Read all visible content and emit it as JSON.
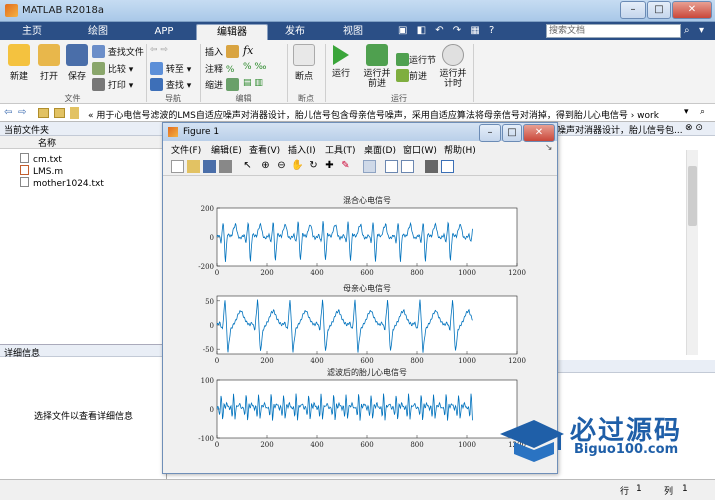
{
  "window": {
    "title": "MATLAB R2018a"
  },
  "tabs": [
    {
      "label": "主页"
    },
    {
      "label": "绘图"
    },
    {
      "label": "APP"
    },
    {
      "label": "编辑器"
    },
    {
      "label": "发布"
    },
    {
      "label": "视图"
    }
  ],
  "search": {
    "placeholder": "搜索文档"
  },
  "ribbon": {
    "new": "新建",
    "open": "打开",
    "save": "保存",
    "find_files": "查找文件",
    "compare": "比较",
    "print": "打印",
    "goto": "转至",
    "find": "查找",
    "insert": "插入",
    "comment": "注释",
    "indent": "缩进",
    "fx": "fx",
    "breakpoints": "断点",
    "run": "运行",
    "run_advance": "运行并\n前进",
    "run_section": "运行节",
    "advance": "前进",
    "run_time": "运行并\n计时",
    "sections": {
      "file": "文件",
      "navigate": "导航",
      "edit": "编辑",
      "breakpoints": "断点",
      "run": "运行"
    }
  },
  "address": {
    "path": "« 用于心电信号滤波的LMS自适应噪声对消器设计，胎儿信号包含母亲信号噪声，采用自适应算法将母亲信号对消掉，得到胎儿心电信号 › work"
  },
  "current_folder": {
    "title": "当前文件夹",
    "column": "名称",
    "files": [
      "cm.txt",
      "LMS.m",
      "mother1024.txt"
    ]
  },
  "details": {
    "title": "详细信息",
    "message": "选择文件以查看详细信息"
  },
  "editor": {
    "header": "噪声对消器设计，胎儿信号包..."
  },
  "status": {
    "row_label": "行",
    "row": "1",
    "col_label": "列",
    "col": "1"
  },
  "figure": {
    "title": "Figure 1",
    "menu": [
      "文件(F)",
      "编辑(E)",
      "查看(V)",
      "插入(I)",
      "工具(T)",
      "桌面(D)",
      "窗口(W)",
      "帮助(H)"
    ]
  },
  "watermark": {
    "text": "必过源码",
    "url": "Biguo100.com"
  },
  "colors": {
    "line": "#0072bd",
    "tabbar": "#2b4f86",
    "ribbon": "#f3f3f3"
  },
  "chart_data": [
    {
      "type": "line",
      "title": "混合心电信号",
      "xlim": [
        0,
        1200
      ],
      "ylim": [
        -200,
        200
      ],
      "xticks": [
        "0",
        "200",
        "400",
        "600",
        "800",
        "1000",
        "1200"
      ],
      "yticks": [
        "200",
        "0",
        "-200"
      ],
      "period": 100,
      "n": 1024,
      "series": [
        {
          "values": [
            0,
            15,
            -40,
            120,
            -180,
            20,
            10,
            5,
            60,
            90,
            10,
            -10,
            0
          ]
        }
      ]
    },
    {
      "type": "line",
      "title": "母亲心电信号",
      "xlim": [
        0,
        1200
      ],
      "ylim": [
        -60,
        60
      ],
      "xticks": [
        "0",
        "200",
        "400",
        "600",
        "800",
        "1000",
        "1200"
      ],
      "yticks": [
        "50",
        "0",
        "-50"
      ],
      "period": 130,
      "n": 1024,
      "series": [
        {
          "values": [
            0,
            5,
            -10,
            55,
            -58,
            -10,
            0,
            10,
            25,
            30,
            15,
            5,
            0
          ]
        }
      ]
    },
    {
      "type": "line",
      "title": "滤波后的胎儿心电信号",
      "xlim": [
        0,
        1200
      ],
      "ylim": [
        -100,
        100
      ],
      "xticks": [
        "0",
        "200",
        "400",
        "600",
        "800",
        "1000",
        "1200"
      ],
      "yticks": [
        "100",
        "0",
        "-100"
      ],
      "period": 50,
      "n": 1024,
      "series": [
        {
          "values": [
            0,
            10,
            -30,
            60,
            -40,
            15,
            5,
            20,
            10,
            0
          ]
        }
      ]
    }
  ]
}
